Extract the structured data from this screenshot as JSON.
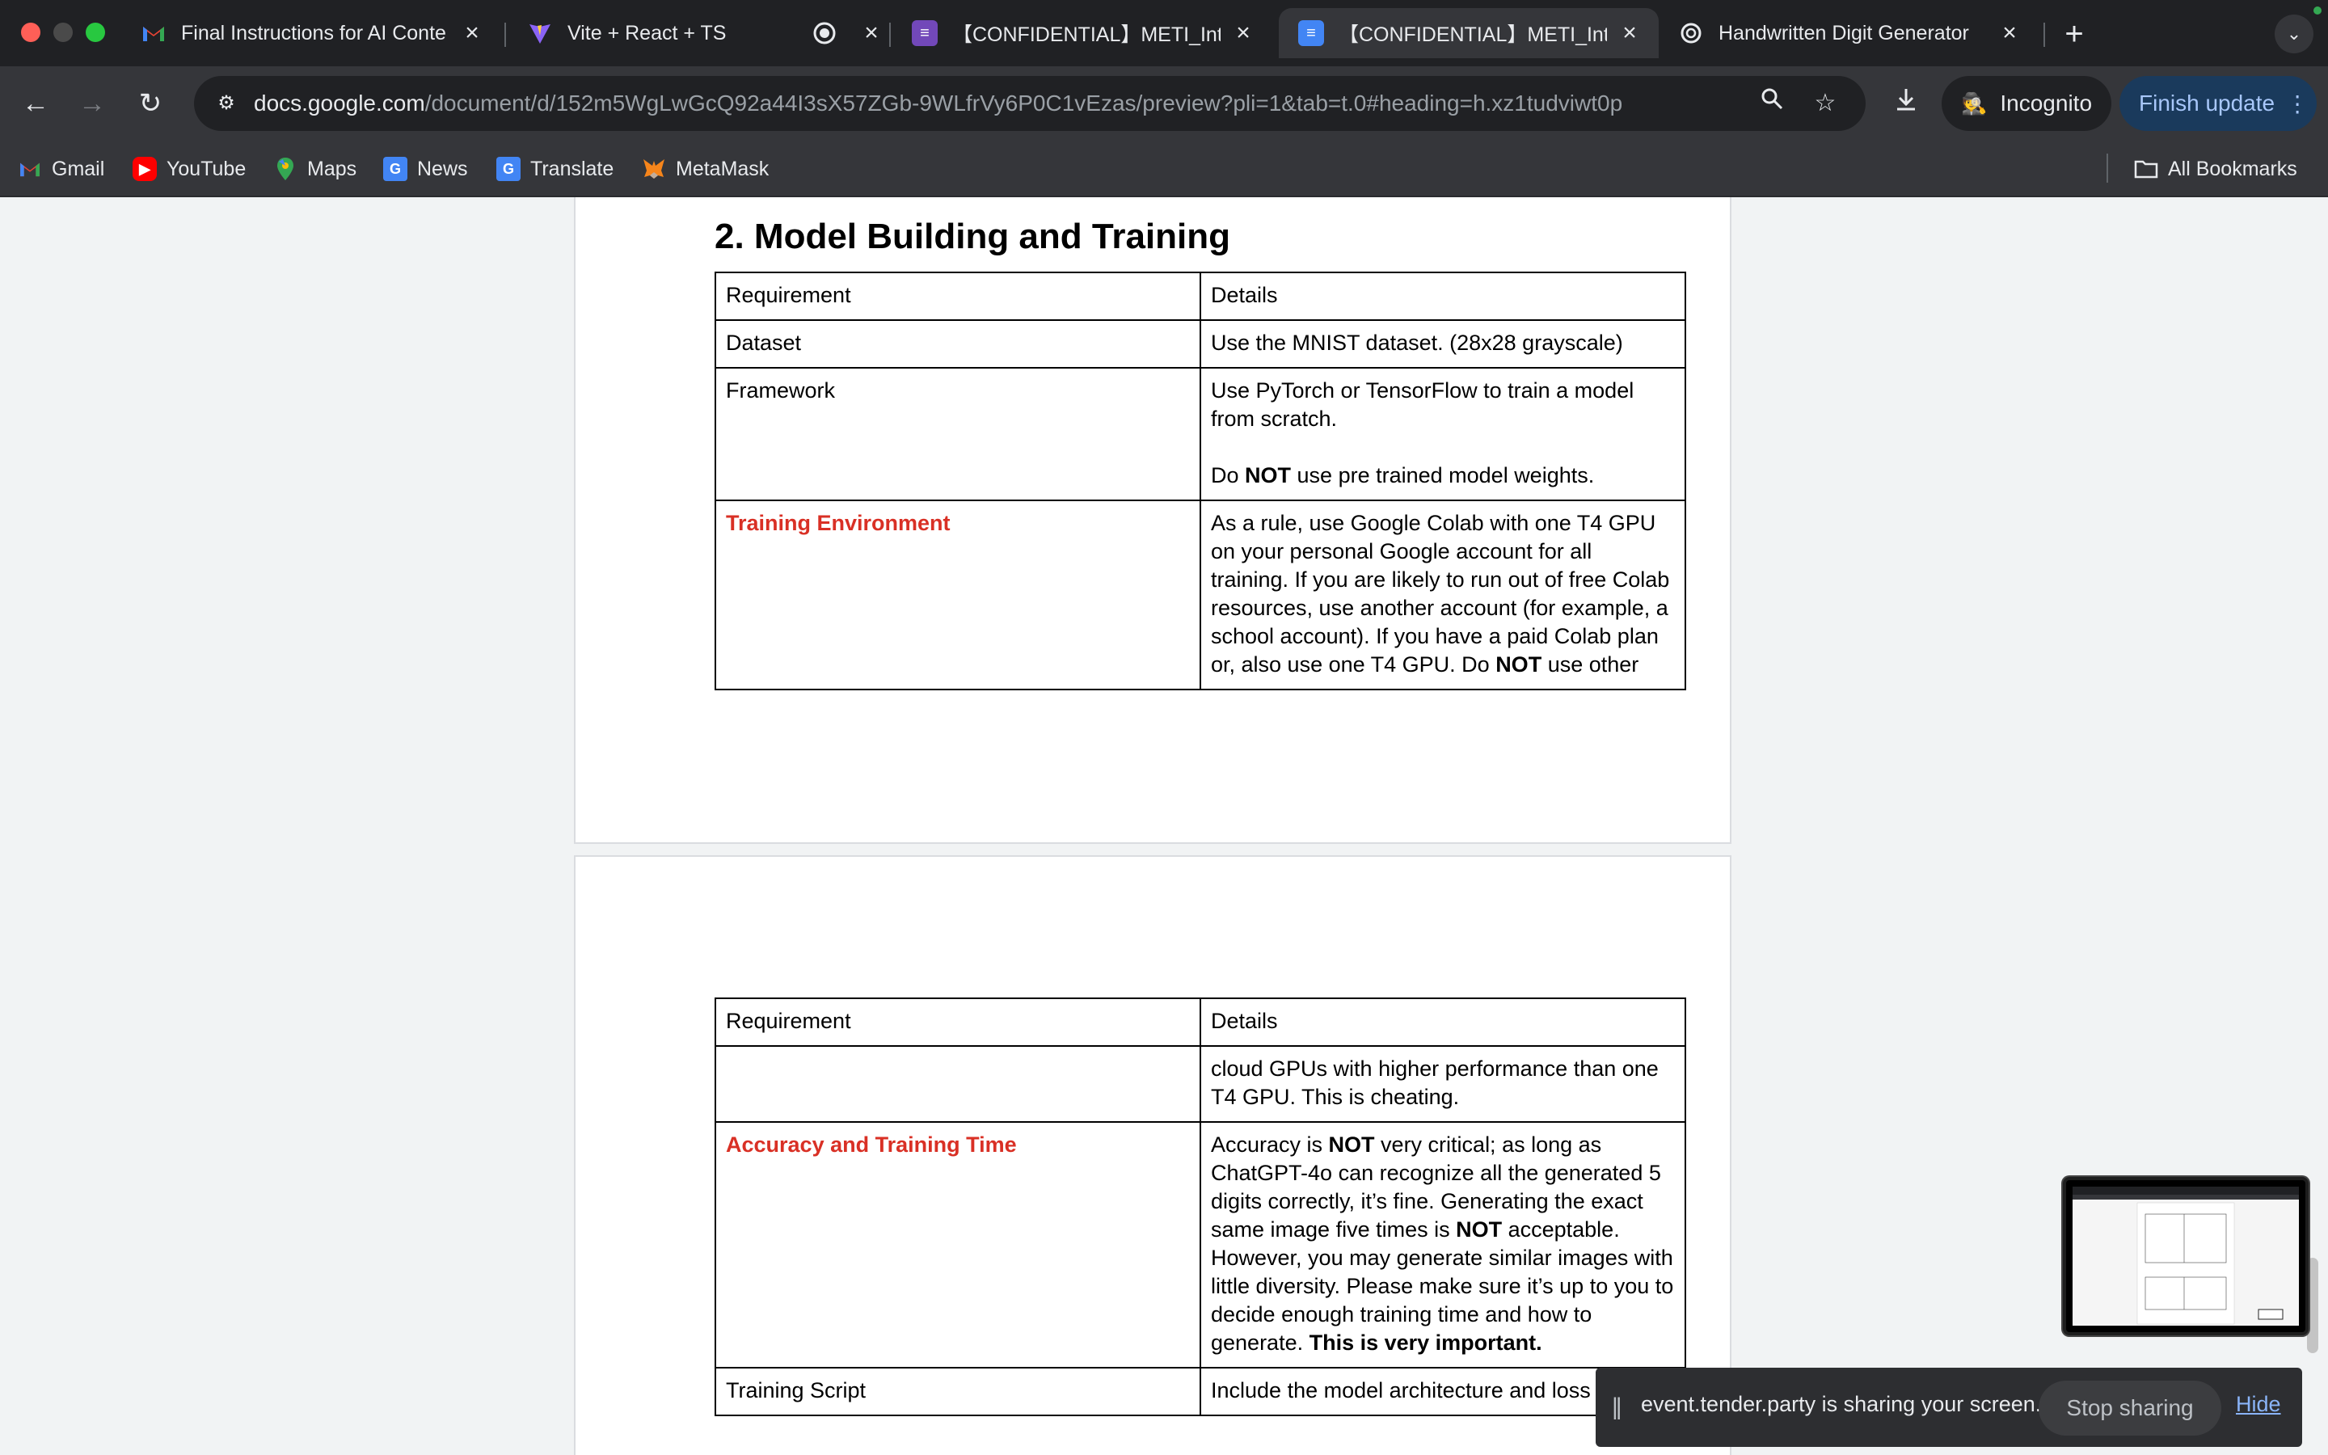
{
  "tabs": [
    {
      "title": "Final Instructions for AI Conte",
      "icon": "gmail-icon",
      "active": false
    },
    {
      "title": "Vite + React + TS",
      "icon": "vite-icon",
      "active": false
    },
    {
      "title": "",
      "icon": "recording-icon",
      "active": false
    },
    {
      "title": "【CONFIDENTIAL】METI_Inte",
      "icon": "google-forms-icon",
      "active": false
    },
    {
      "title": "【CONFIDENTIAL】METI_Inte",
      "icon": "google-docs-icon",
      "active": true
    },
    {
      "title": "Handwritten Digit Generator",
      "icon": "openai-icon",
      "active": false
    }
  ],
  "toolbar": {
    "url_host": "docs.google.com",
    "url_path": "/document/d/152m5WgLwGcQ92a44I3sX57ZGb-9WLfrVy6P0C1vEzas/preview?pli=1&tab=t.0#heading=h.xz1tudviwt0p",
    "incognito_label": "Incognito",
    "finish_update_label": "Finish update"
  },
  "bookmarks": [
    {
      "label": "Gmail",
      "icon": "gmail-icon"
    },
    {
      "label": "YouTube",
      "icon": "youtube-icon"
    },
    {
      "label": "Maps",
      "icon": "maps-icon"
    },
    {
      "label": "News",
      "icon": "news-icon"
    },
    {
      "label": "Translate",
      "icon": "translate-icon"
    },
    {
      "label": "MetaMask",
      "icon": "metamask-icon"
    }
  ],
  "all_bookmarks_label": "All Bookmarks",
  "document": {
    "section_heading": "2. Model Building and Training",
    "table1": {
      "header": [
        "Requirement",
        "Details"
      ],
      "rows": [
        {
          "req": "Dataset",
          "details": "Use the MNIST dataset. (28x28 grayscale)"
        },
        {
          "req": "Framework",
          "details_1": "Use PyTorch or TensorFlow to train a model from scratch.",
          "details_2_pre": "Do ",
          "details_2_bold": "NOT",
          "details_2_post": " use pre trained model weights."
        },
        {
          "req": "Training Environment",
          "details_pre": "As a rule, use Google Colab with one T4 GPU on your personal Google account for all training. If you are likely to run out of free Colab resources, use another account (for example, a school account). If you have a paid Colab plan or, also use one T4 GPU. Do ",
          "details_bold": "NOT",
          "details_post": " use other"
        }
      ]
    },
    "table2": {
      "header": [
        "Requirement",
        "Details"
      ],
      "rows": [
        {
          "req": "",
          "details": "cloud GPUs with higher performance than one T4 GPU. This is cheating."
        },
        {
          "req": "Accuracy and Training Time",
          "p1": "Accuracy is ",
          "b1": "NOT",
          "p2": " very critical; as long as ChatGPT-4o can recognize all the generated 5 digits correctly, it’s fine. Generating the exact same image five times is ",
          "b2": "NOT",
          "p3": " acceptable. However, you may generate similar images with little diversity. Please make sure it’s up to you to decide enough training time and how to generate. ",
          "b3": "This is very important."
        },
        {
          "req": "Training Script",
          "details": "Include the model architecture and loss fu"
        }
      ]
    }
  },
  "sharing_bar": {
    "text": "event.tender.party is sharing your screen.",
    "stop_label": "Stop sharing",
    "hide_label": "Hide"
  },
  "colors": {
    "accent_red": "#d93025",
    "chrome_dark": "#202124",
    "chrome_toolbar": "#35363a"
  }
}
